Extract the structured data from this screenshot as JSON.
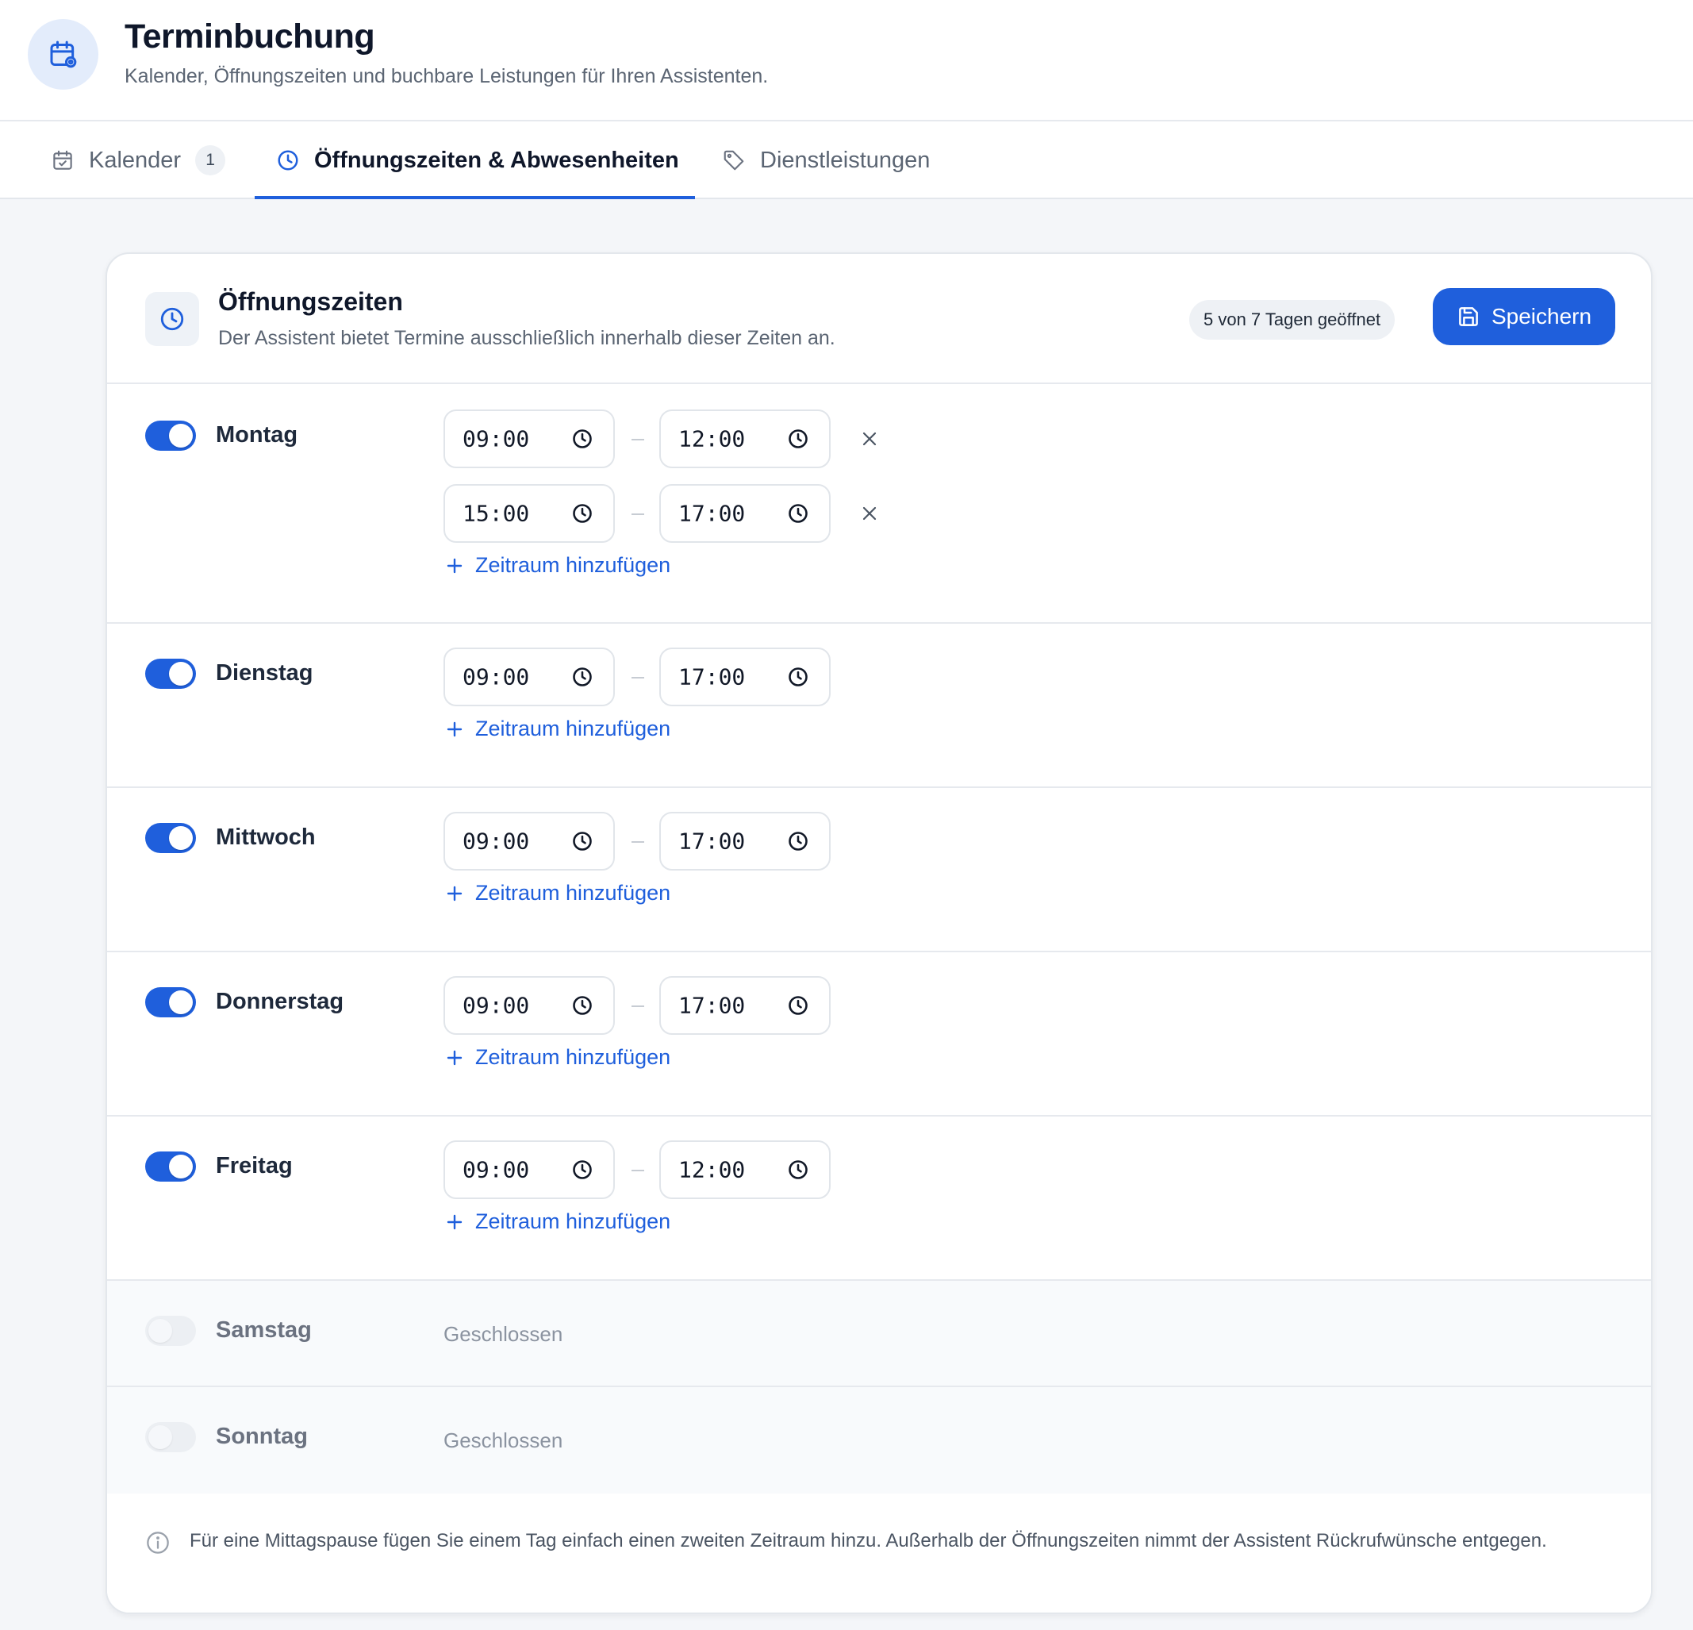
{
  "header": {
    "title": "Terminbuchung",
    "subtitle": "Kalender, Öffnungszeiten und buchbare Leistungen für Ihren Assistenten.",
    "icon": "calendar-cog-icon"
  },
  "tabs": [
    {
      "label": "Kalender",
      "badge": "1",
      "icon": "calendar-icon",
      "active": false
    },
    {
      "label": "Öffnungszeiten & Abwesenheiten",
      "icon": "clock-icon",
      "active": true
    },
    {
      "label": "Dienstleistungen",
      "icon": "tag-icon",
      "active": false
    }
  ],
  "card": {
    "title": "Öffnungszeiten",
    "subtitle": "Der Assistent bietet Termine ausschließlich innerhalb dieser Zeiten an.",
    "status": "5 von 7 Tagen geöffnet",
    "save_label": "Speichern",
    "add_range_label": "Zeitraum hinzufügen",
    "closed_label": "Geschlossen"
  },
  "days": [
    {
      "name": "Montag",
      "enabled": true,
      "ranges": [
        {
          "from": "09:00",
          "to": "12:00"
        },
        {
          "from": "15:00",
          "to": "17:00"
        }
      ]
    },
    {
      "name": "Dienstag",
      "enabled": true,
      "ranges": [
        {
          "from": "09:00",
          "to": "17:00"
        }
      ]
    },
    {
      "name": "Mittwoch",
      "enabled": true,
      "ranges": [
        {
          "from": "09:00",
          "to": "17:00"
        }
      ]
    },
    {
      "name": "Donnerstag",
      "enabled": true,
      "ranges": [
        {
          "from": "09:00",
          "to": "17:00"
        }
      ]
    },
    {
      "name": "Freitag",
      "enabled": true,
      "ranges": [
        {
          "from": "09:00",
          "to": "12:00"
        }
      ]
    },
    {
      "name": "Samstag",
      "enabled": false,
      "ranges": []
    },
    {
      "name": "Sonntag",
      "enabled": false,
      "ranges": []
    }
  ],
  "note": {
    "text": "Für eine Mittagspause fügen Sie einem Tag einfach einen zweiten Zeitraum hinzu. Außerhalb der Öffnungszeiten nimmt der Assistent Rückrufwünsche entgegen.",
    "icon": "info-icon"
  },
  "colors": {
    "accent": "#1f5fdc",
    "page_background": "#f4f6f9",
    "toggle_off": "#eceff3"
  }
}
